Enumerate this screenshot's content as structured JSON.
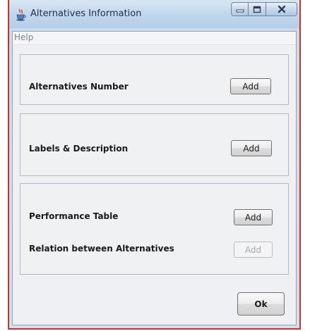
{
  "window": {
    "title": "Alternatives Information",
    "controls": [
      "minimize",
      "maximize",
      "close"
    ]
  },
  "menubar": {
    "items": [
      "Help"
    ]
  },
  "sections": {
    "alternatives_number": {
      "label": "Alternatives Number",
      "button": "Add",
      "enabled": true
    },
    "labels_description": {
      "label": "Labels & Description",
      "button": "Add",
      "enabled": true
    },
    "performance_table": {
      "label": "Performance Table",
      "button": "Add",
      "enabled": true
    },
    "relation_alternatives": {
      "label": "Relation between Alternatives",
      "button": "Add",
      "enabled": false
    }
  },
  "footer": {
    "ok_label": "Ok"
  },
  "colors": {
    "frame_border": "#c8312c",
    "titlebar": "#c2d7ec",
    "client_bg": "#eef0f3"
  },
  "icons": {
    "app": "java-cup-icon",
    "minimize": "minimize-icon",
    "maximize": "maximize-icon",
    "close": "close-icon"
  }
}
